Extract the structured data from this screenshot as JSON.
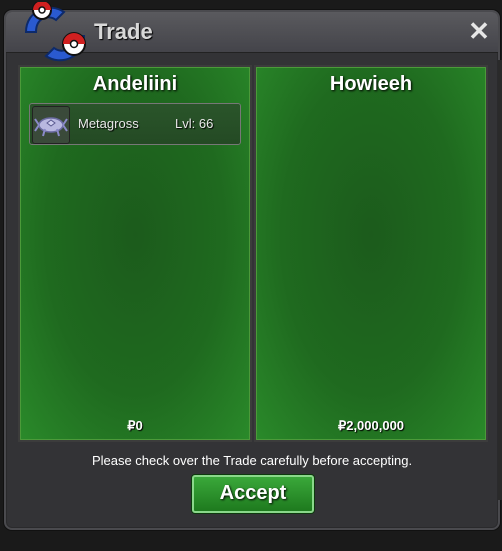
{
  "window": {
    "title": "Trade",
    "close_symbol": "✕"
  },
  "left_panel": {
    "player_name": "Andeliini",
    "items": [
      {
        "icon": "metagross-icon",
        "name": "Metagross",
        "level": "Lvl: 66"
      }
    ],
    "money": "₽0"
  },
  "right_panel": {
    "player_name": "Howieeh",
    "items": [],
    "money": "₽2,000,000"
  },
  "footer": {
    "notice": "Please check over the Trade carefully before accepting.",
    "accept_label": "Accept"
  },
  "colors": {
    "panel_green": "#1f6a1f",
    "accept_green": "#2a922a",
    "window_bg": "#333336"
  }
}
